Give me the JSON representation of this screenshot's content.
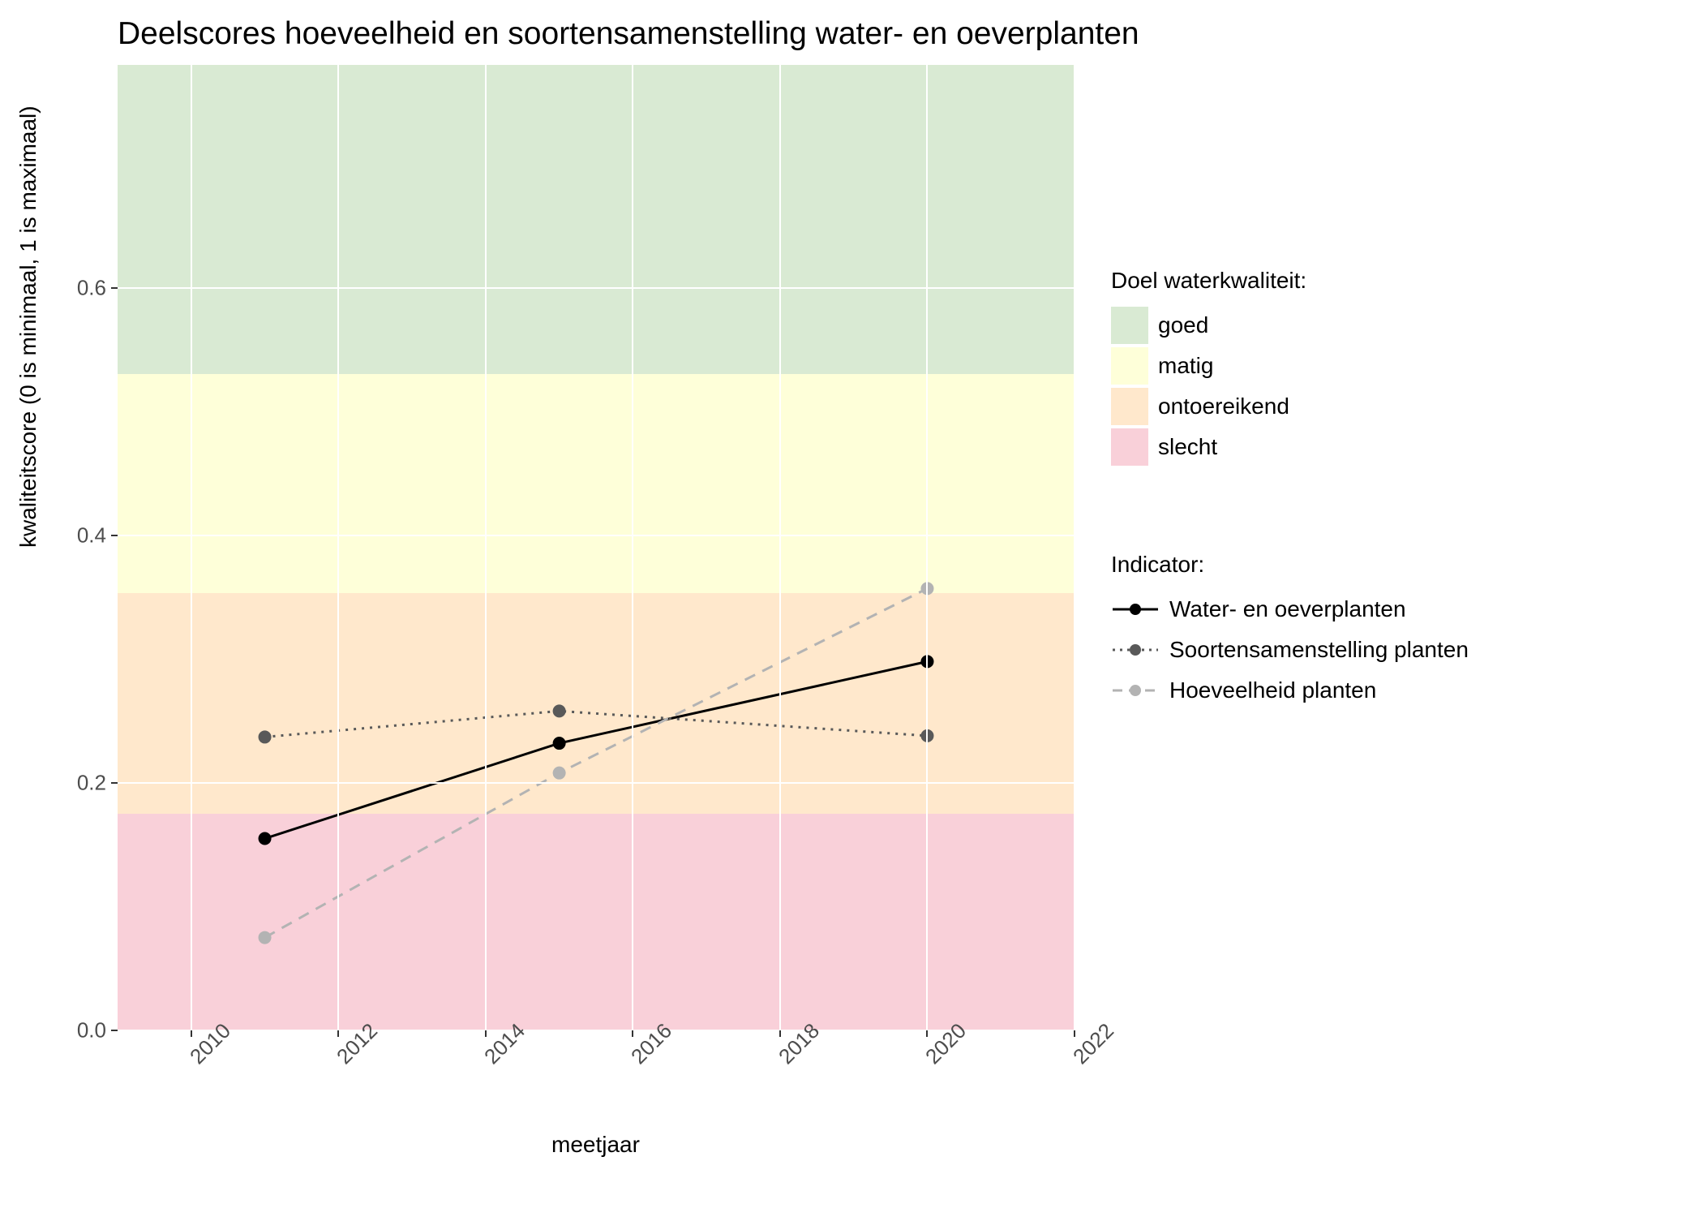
{
  "title": "Deelscores hoeveelheid en soortensamenstelling water- en oeverplanten",
  "xlabel": "meetjaar",
  "ylabel": "kwaliteitscore (0 is minimaal, 1 is maximaal)",
  "legend_bands_title": "Doel waterkwaliteit:",
  "legend_series_title": "Indicator:",
  "bands": {
    "goed": {
      "label": "goed",
      "color": "#d9ead3"
    },
    "matig": {
      "label": "matig",
      "color": "#feffd9"
    },
    "ontoereikend": {
      "label": "ontoereikend",
      "color": "#ffe8cc"
    },
    "slecht": {
      "label": "slecht",
      "color": "#f9d0d9"
    }
  },
  "series": {
    "s1": {
      "label": "Water- en oeverplanten"
    },
    "s2": {
      "label": "Soortensamenstelling planten"
    },
    "s3": {
      "label": "Hoeveelheid planten"
    }
  },
  "chart_data": {
    "type": "line",
    "title": "Deelscores hoeveelheid en soortensamenstelling water- en oeverplanten",
    "xlabel": "meetjaar",
    "ylabel": "kwaliteitscore (0 is minimaal, 1 is maximaal)",
    "x": [
      2011,
      2015,
      2020
    ],
    "x_ticks": [
      2010,
      2012,
      2014,
      2016,
      2018,
      2020,
      2022
    ],
    "y_ticks": [
      0.0,
      0.2,
      0.4,
      0.6
    ],
    "ylim": [
      0.0,
      0.78
    ],
    "xlim": [
      2009,
      2022
    ],
    "series": [
      {
        "name": "Water- en oeverplanten",
        "style": "solid",
        "color": "#000000",
        "values": [
          0.155,
          0.232,
          0.298
        ]
      },
      {
        "name": "Soortensamenstelling planten",
        "style": "dotted",
        "color": "#595959",
        "values": [
          0.237,
          0.258,
          0.238
        ]
      },
      {
        "name": "Hoeveelheid planten",
        "style": "dashed",
        "color": "#b3b3b3",
        "values": [
          0.075,
          0.208,
          0.357
        ]
      }
    ],
    "bands": [
      {
        "name": "goed",
        "from": 0.53,
        "to": 0.78,
        "color": "#d9ead3"
      },
      {
        "name": "matig",
        "from": 0.353,
        "to": 0.53,
        "color": "#feffd9"
      },
      {
        "name": "ontoereikend",
        "from": 0.175,
        "to": 0.353,
        "color": "#ffe8cc"
      },
      {
        "name": "slecht",
        "from": 0.0,
        "to": 0.175,
        "color": "#f9d0d9"
      }
    ]
  }
}
